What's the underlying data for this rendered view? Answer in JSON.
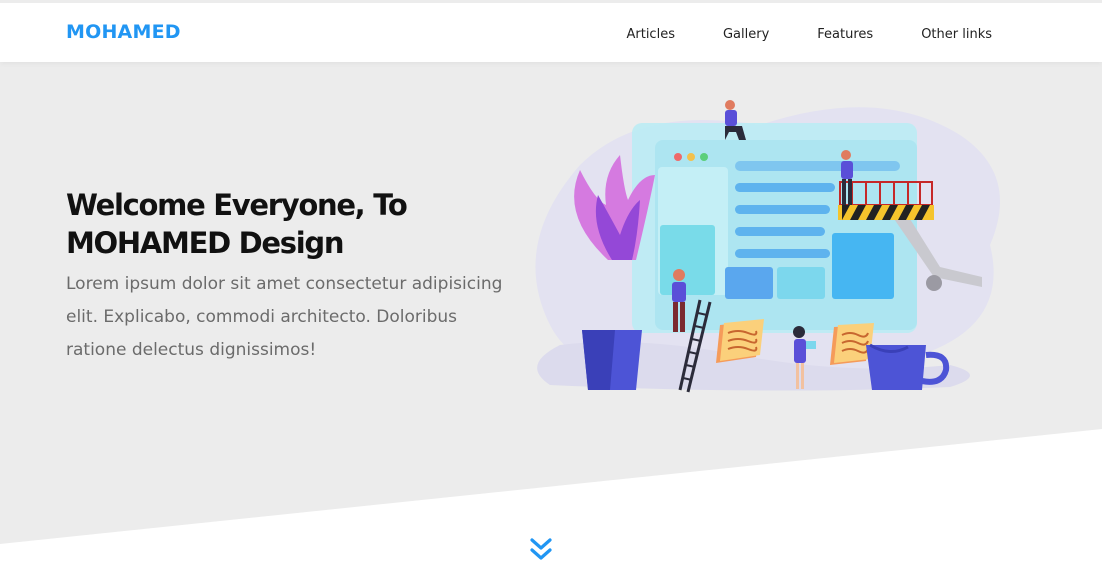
{
  "header": {
    "logo": "MOHAMED",
    "nav": [
      {
        "label": "Articles"
      },
      {
        "label": "Gallery"
      },
      {
        "label": "Features"
      },
      {
        "label": "Other links"
      }
    ]
  },
  "hero": {
    "title": "Welcome Everyone, To MOHAMED Design",
    "description": "Lorem ipsum dolor sit amet consectetur adipisicing elit. Explicabo, commodi architecto. Doloribus ratione delectus dignissimos!"
  },
  "icons": {
    "scroll_down": "double-chevron-down-icon"
  },
  "colors": {
    "accent": "#2196f3",
    "hero_background": "#ececec",
    "title": "#111111",
    "body_text": "#6b6b6b"
  }
}
